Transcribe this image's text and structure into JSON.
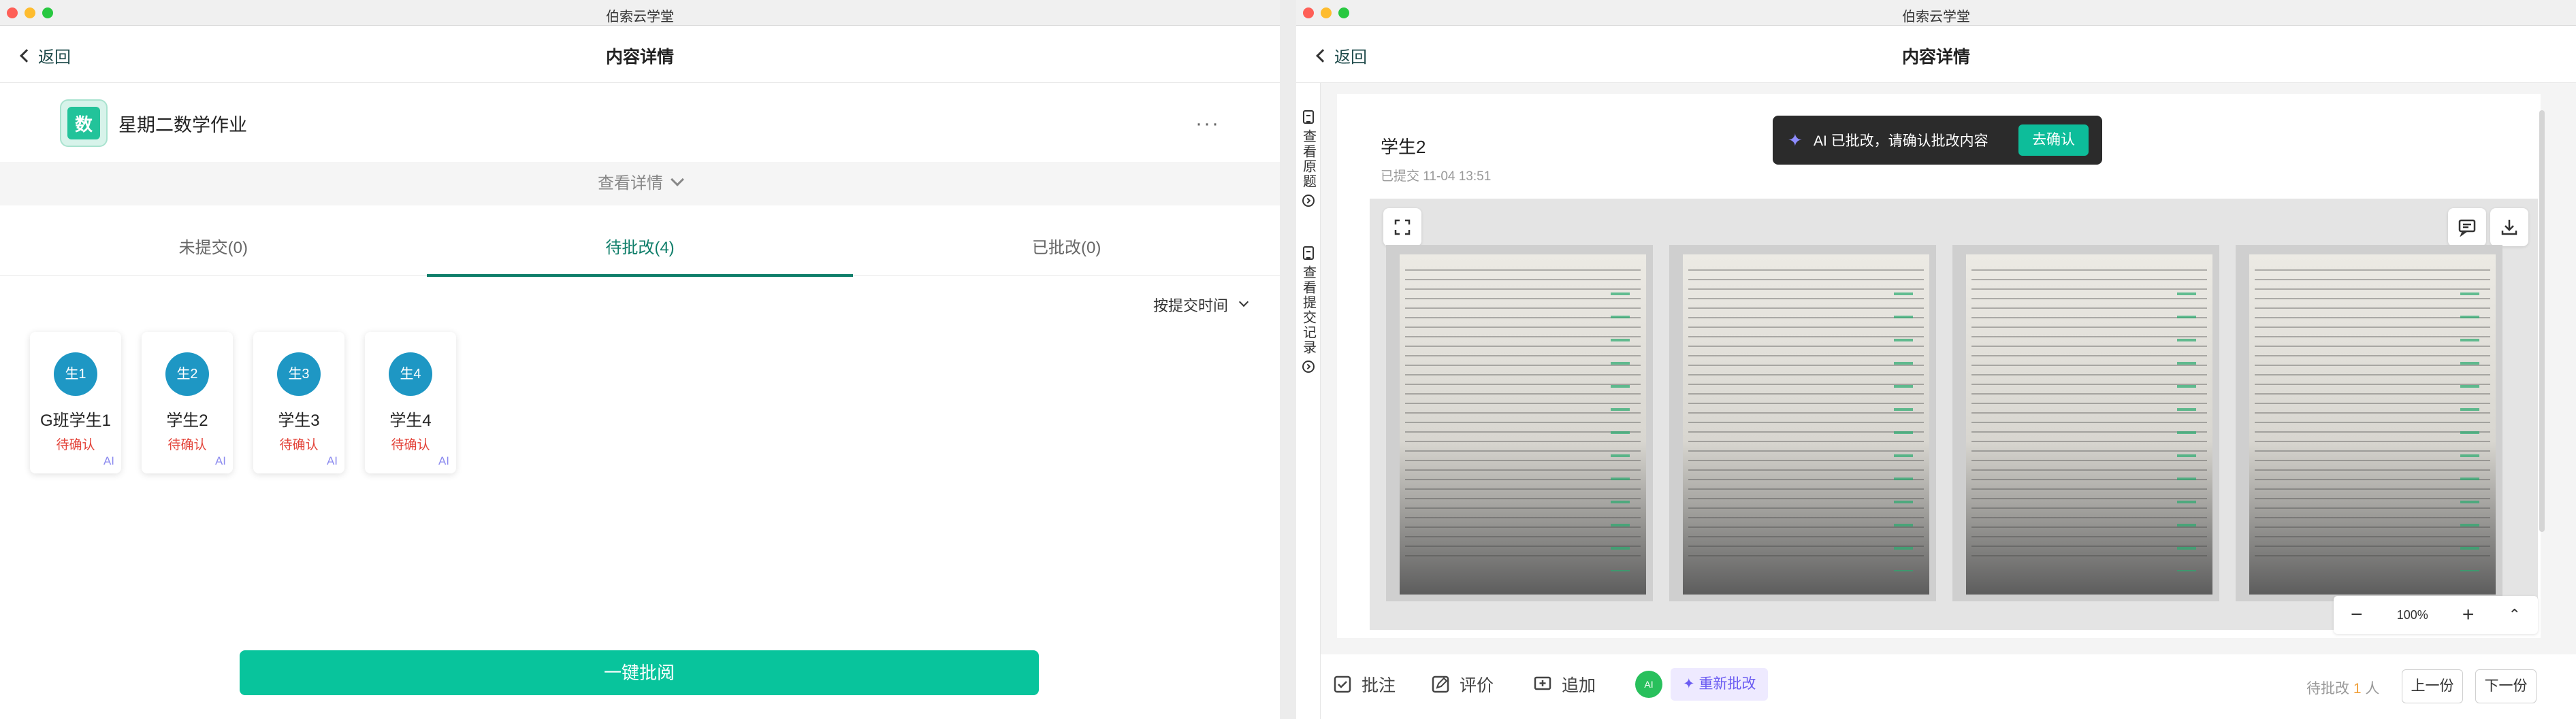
{
  "left": {
    "window_title": "伯索云学堂",
    "back_label": "返回",
    "page_title": "内容详情",
    "homework": {
      "icon_char": "数",
      "title": "星期二数学作业"
    },
    "more_label": "···",
    "view_detail_label": "查看详情",
    "tabs": [
      {
        "label": "未提交(0)"
      },
      {
        "label": "待批改(4)"
      },
      {
        "label": "已批改(0)"
      }
    ],
    "sort_label": "按提交时间",
    "students": [
      {
        "avatar": "生1",
        "name": "G班学生1",
        "status": "待确认",
        "badge": "AI"
      },
      {
        "avatar": "生2",
        "name": "学生2",
        "status": "待确认",
        "badge": "AI"
      },
      {
        "avatar": "生3",
        "name": "学生3",
        "status": "待确认",
        "badge": "AI"
      },
      {
        "avatar": "生4",
        "name": "学生4",
        "status": "待确认",
        "badge": "AI"
      }
    ],
    "one_key_label": "一键批阅"
  },
  "right": {
    "window_title": "伯索云学堂",
    "back_label": "返回",
    "page_title": "内容详情",
    "sidebar": {
      "view_question": "查看原题",
      "view_record": "查看提交记录"
    },
    "student_name": "学生2",
    "submit_time": "已提交 11-04 13:51",
    "toast": {
      "text": "AI 已批改，请确认批改内容",
      "button": "去确认"
    },
    "zoom_level": "100%",
    "bottom": {
      "annotate": "批注",
      "evaluate": "评价",
      "append": "追加",
      "regrade": "重新批改",
      "pending_prefix": "待批改",
      "pending_count": "1",
      "pending_suffix": "人",
      "prev": "上一份",
      "next": "下一份"
    }
  },
  "colors": {
    "accent": "#0f7e6a",
    "button": "#08c49c",
    "avatar": "#1e97c4",
    "status": "#e3443a",
    "ai": "#8c8bef"
  }
}
